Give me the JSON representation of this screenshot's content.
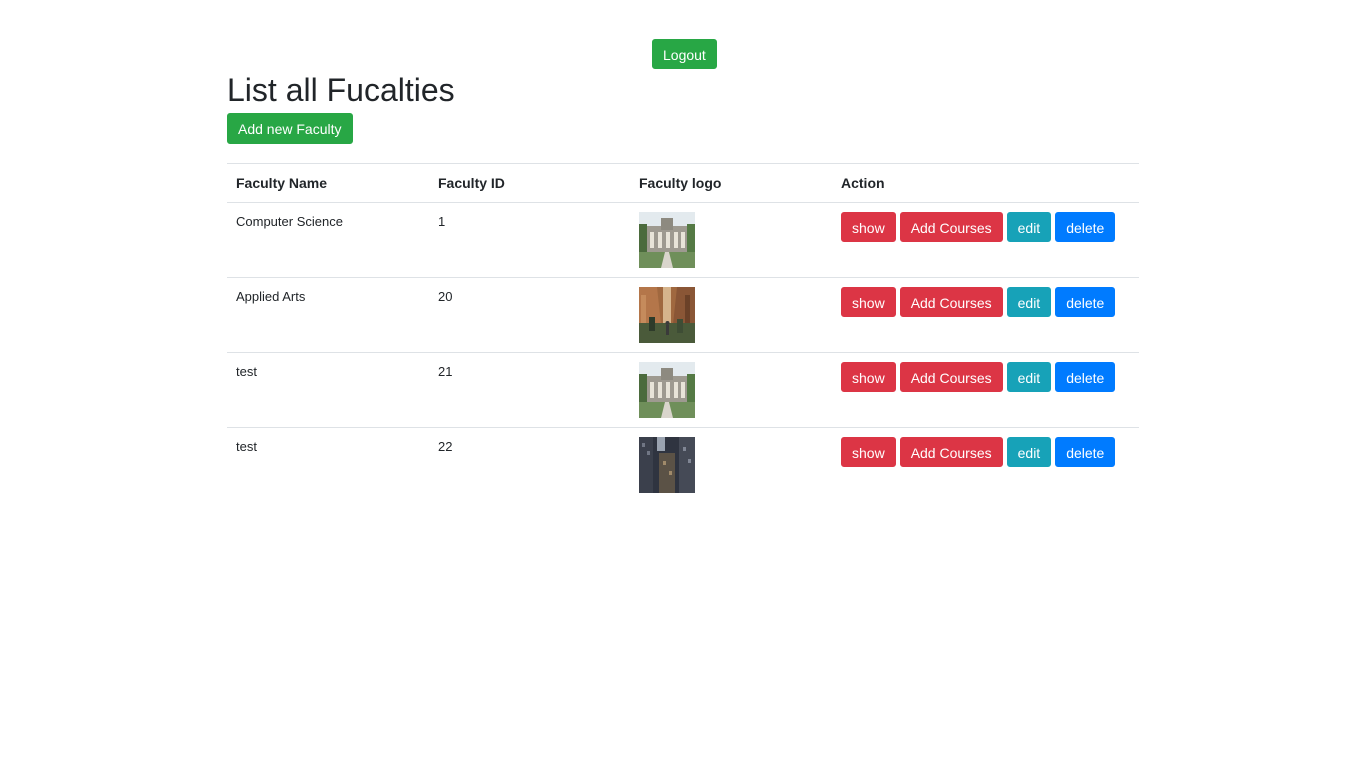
{
  "header": {
    "logout_label": "Logout",
    "title": "List all Fucalties",
    "add_label": "Add new Faculty"
  },
  "table": {
    "columns": [
      "Faculty Name",
      "Faculty ID",
      "Faculty logo",
      "Action"
    ],
    "rows": [
      {
        "name": "Computer Science",
        "id": "1",
        "logo": "building-photo"
      },
      {
        "name": "Applied Arts",
        "id": "20",
        "logo": "street-photo"
      },
      {
        "name": "test",
        "id": "21",
        "logo": "building-photo"
      },
      {
        "name": "test",
        "id": "22",
        "logo": "dark-towers-photo"
      }
    ],
    "actions": {
      "show": "show",
      "add_courses": "Add Courses",
      "edit": "edit",
      "delete": "delete"
    }
  },
  "colors": {
    "success": "#28a745",
    "danger": "#dc3545",
    "info": "#17a2b8",
    "primary": "#007bff"
  }
}
